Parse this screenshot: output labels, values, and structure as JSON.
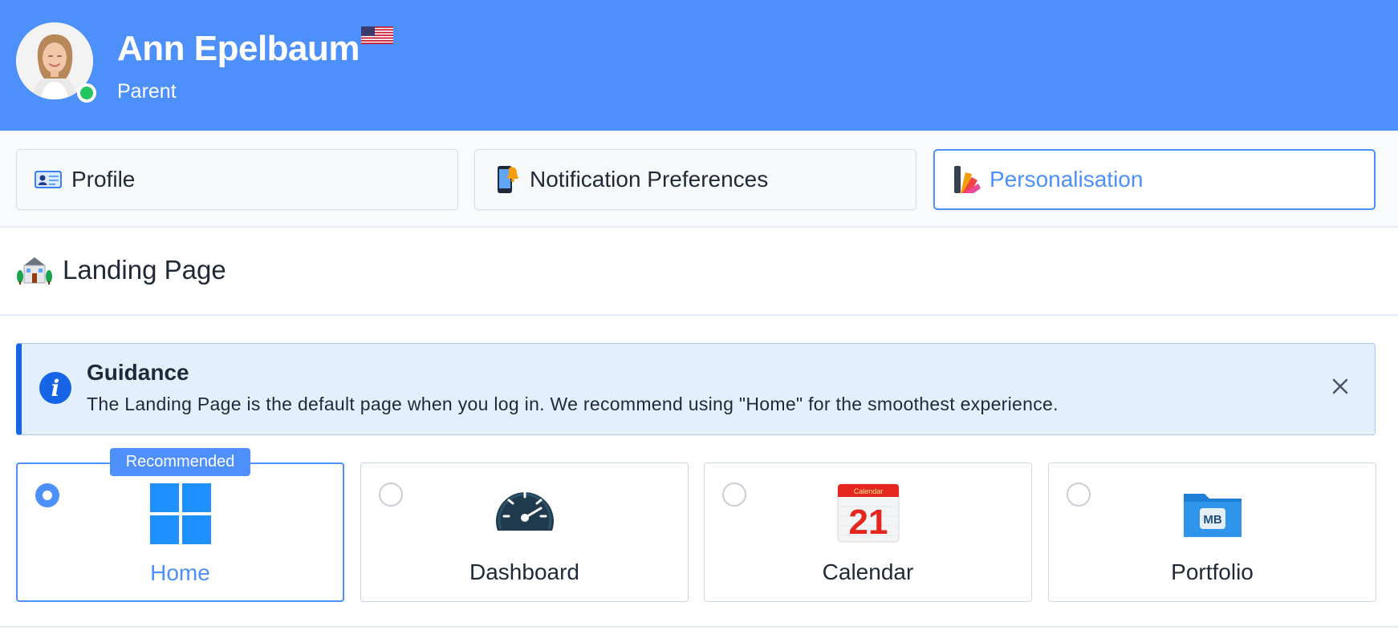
{
  "header": {
    "name": "Ann Epelbaum",
    "role": "Parent",
    "flag_icon": "us-flag-icon",
    "status": "online",
    "colors": {
      "background": "#4d8ffb",
      "status": "#22c55e"
    }
  },
  "tabs": [
    {
      "label": "Profile",
      "icon": "id-card-icon",
      "active": false
    },
    {
      "label": "Notification Preferences",
      "icon": "phone-notification-icon",
      "active": false
    },
    {
      "label": "Personalisation",
      "icon": "palette-icon",
      "active": true
    }
  ],
  "section": {
    "title": "Landing Page",
    "icon": "house-icon"
  },
  "alert": {
    "title": "Guidance",
    "text": "The Landing Page is the default page when you log in. We recommend using \"Home\" for the smoothest experience.",
    "icon": "info-icon",
    "close_icon": "close-icon",
    "colors": {
      "background": "#e4effd",
      "accent": "#1565e6"
    }
  },
  "landing_options": {
    "badge": "Recommended",
    "selected": "Home",
    "items": [
      {
        "label": "Home",
        "icon": "windows-grid-icon",
        "selected": true
      },
      {
        "label": "Dashboard",
        "icon": "speedometer-icon",
        "selected": false
      },
      {
        "label": "Calendar",
        "icon": "calendar-icon",
        "selected": false
      },
      {
        "label": "Portfolio",
        "icon": "folder-icon",
        "selected": false
      }
    ],
    "calendar_icon_text": {
      "month": "Calendar",
      "day": "21"
    },
    "folder_icon_text": "MB"
  },
  "accent_color": "#4d8ffb"
}
